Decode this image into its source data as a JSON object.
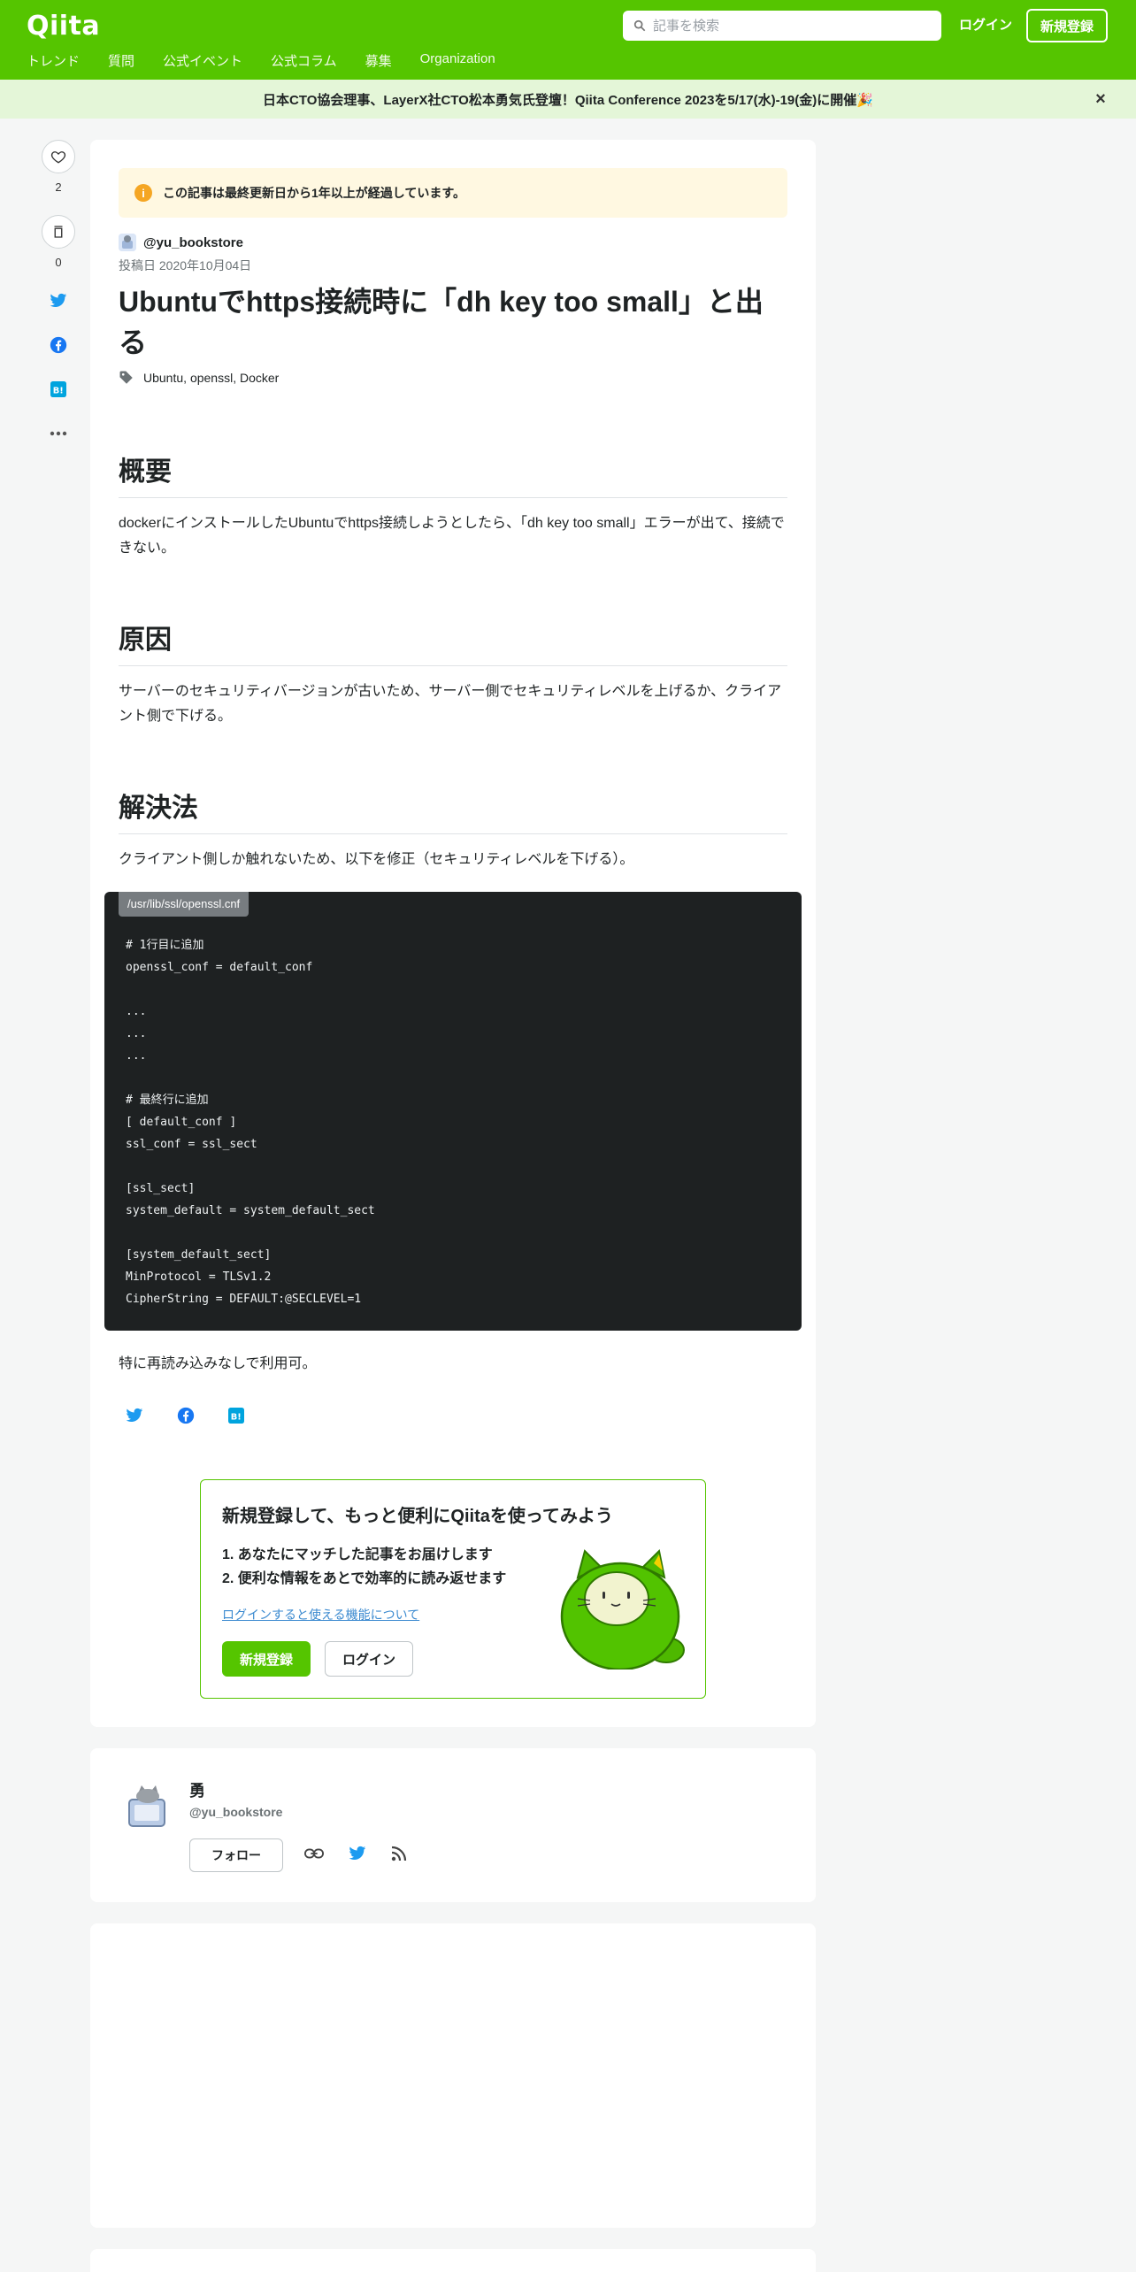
{
  "header": {
    "logo": "Qiita",
    "search_placeholder": "記事を検索",
    "login": "ログイン",
    "signup": "新規登録",
    "nav": [
      "トレンド",
      "質問",
      "公式イベント",
      "公式コラム",
      "募集",
      "Organization"
    ],
    "brand_color": "#55c500"
  },
  "banner": {
    "text": "日本CTO協会理事、LayerX社CTO松本勇気氏登壇！Qiita Conference 2023を5/17(水)-19(金)に開催🎉",
    "close": "×"
  },
  "sidebar": {
    "like_count": "2",
    "stock_count": "0"
  },
  "article": {
    "notice": "この記事は最終更新日から1年以上が経過しています。",
    "author": "@yu_bookstore",
    "posted": "投稿日 2020年10月04日",
    "title": "Ubuntuでhttps接続時に「dh key too small」と出る",
    "tags": [
      "Ubuntu",
      "openssl",
      "Docker"
    ],
    "sections": [
      {
        "heading": "概要",
        "body": "dockerにインストールしたUbuntuでhttps接続しようとしたら、「dh key too small」エラーが出て、接続できない。"
      },
      {
        "heading": "原因",
        "body": "サーバーのセキュリティバージョンが古いため、サーバー側でセキュリティレベルを上げるか、クライアント側で下げる。"
      },
      {
        "heading": "解決法",
        "body": "クライアント側しか触れないため、以下を修正（セキュリティレベルを下げる）。"
      }
    ],
    "code_filename": "/usr/lib/ssl/openssl.cnf",
    "code": "# 1行目に追加\nopenssl_conf = default_conf\n\n...\n...\n...\n\n# 最終行に追加\n[ default_conf ]\nssl_conf = ssl_sect\n\n[ssl_sect]\nsystem_default = system_default_sect\n\n[system_default_sect]\nMinProtocol = TLSv1.2\nCipherString = DEFAULT:@SECLEVEL=1",
    "footer_text": "特に再読み込みなしで利用可。"
  },
  "promo": {
    "title": "新規登録して、もっと便利にQiitaを使ってみよう",
    "line1": "1. あなたにマッチした記事をお届けします",
    "line2": "2. 便利な情報をあとで効率的に読み返せます",
    "link": "ログインすると使える機能について",
    "signup": "新規登録",
    "login": "ログイン"
  },
  "author_card": {
    "name": "勇",
    "handle": "@yu_bookstore",
    "follow": "フォロー"
  }
}
